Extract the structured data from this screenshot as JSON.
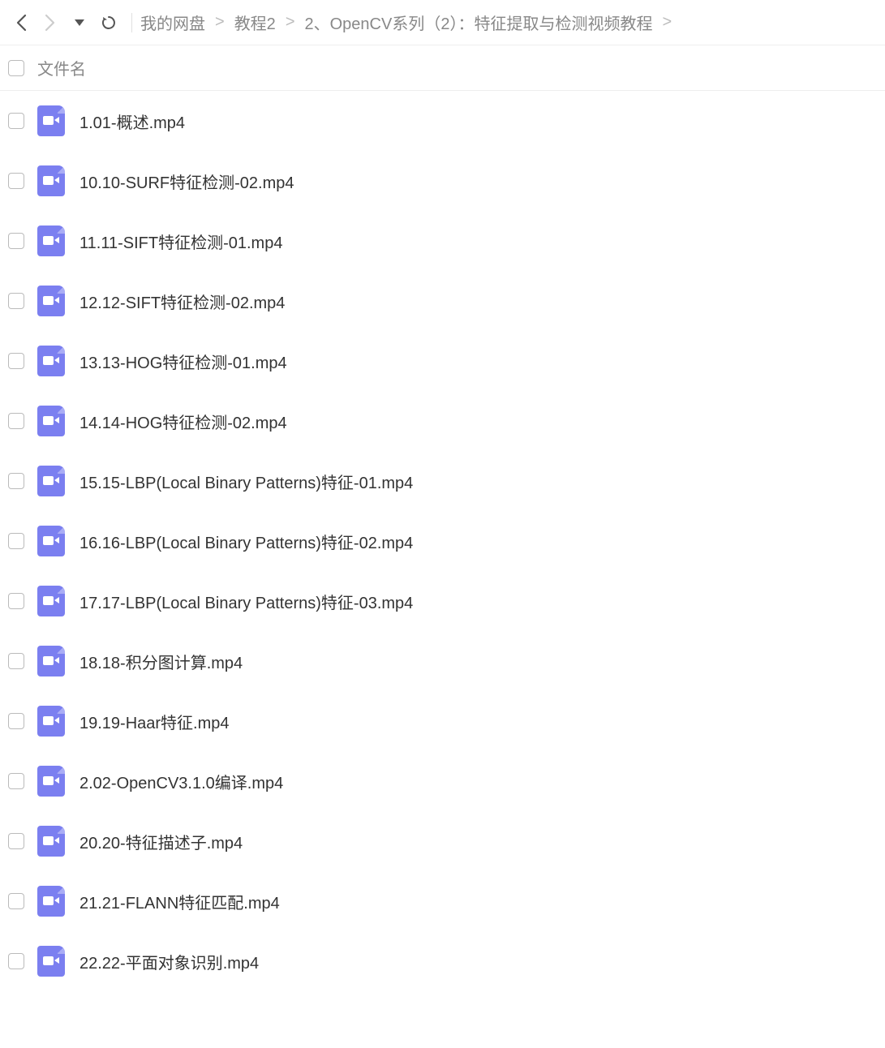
{
  "breadcrumb": {
    "items": [
      {
        "label": "我的网盘"
      },
      {
        "label": "教程2"
      },
      {
        "label": "2、OpenCV系列（2）：特征提取与检测视频教程"
      }
    ],
    "sep": ">"
  },
  "columns": {
    "name": "文件名"
  },
  "files": [
    {
      "name": "1.01-概述.mp4"
    },
    {
      "name": "10.10-SURF特征检测-02.mp4"
    },
    {
      "name": "11.11-SIFT特征检测-01.mp4"
    },
    {
      "name": "12.12-SIFT特征检测-02.mp4"
    },
    {
      "name": "13.13-HOG特征检测-01.mp4"
    },
    {
      "name": "14.14-HOG特征检测-02.mp4"
    },
    {
      "name": "15.15-LBP(Local Binary Patterns)特征-01.mp4"
    },
    {
      "name": "16.16-LBP(Local Binary Patterns)特征-02.mp4"
    },
    {
      "name": "17.17-LBP(Local Binary Patterns)特征-03.mp4"
    },
    {
      "name": "18.18-积分图计算.mp4"
    },
    {
      "name": "19.19-Haar特征.mp4"
    },
    {
      "name": "2.02-OpenCV3.1.0编译.mp4"
    },
    {
      "name": "20.20-特征描述子.mp4"
    },
    {
      "name": "21.21-FLANN特征匹配.mp4"
    },
    {
      "name": "22.22-平面对象识别.mp4"
    }
  ]
}
